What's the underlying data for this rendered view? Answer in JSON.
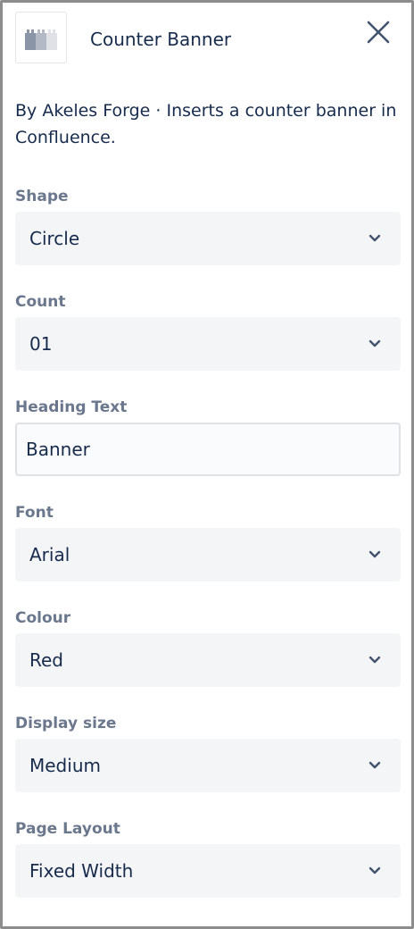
{
  "header": {
    "app_icon": "app-logo-icon",
    "title": "Counter Banner",
    "close_icon": "close-icon"
  },
  "description": "By Akeles Forge · Inserts a counter banner in Confluence.",
  "fields": {
    "shape": {
      "label": "Shape",
      "value": "Circle"
    },
    "count": {
      "label": "Count",
      "value": "01"
    },
    "heading_text": {
      "label": "Heading Text",
      "value": "Banner"
    },
    "font": {
      "label": "Font",
      "value": "Arial"
    },
    "colour": {
      "label": "Colour",
      "value": "Red"
    },
    "display_size": {
      "label": "Display size",
      "value": "Medium"
    },
    "page_layout": {
      "label": "Page Layout",
      "value": "Fixed Width"
    }
  },
  "colors": {
    "text_primary": "#172b4d",
    "label_grey": "#6b778c",
    "field_background": "#f4f5f7",
    "panel_border": "#8d8d8d"
  }
}
